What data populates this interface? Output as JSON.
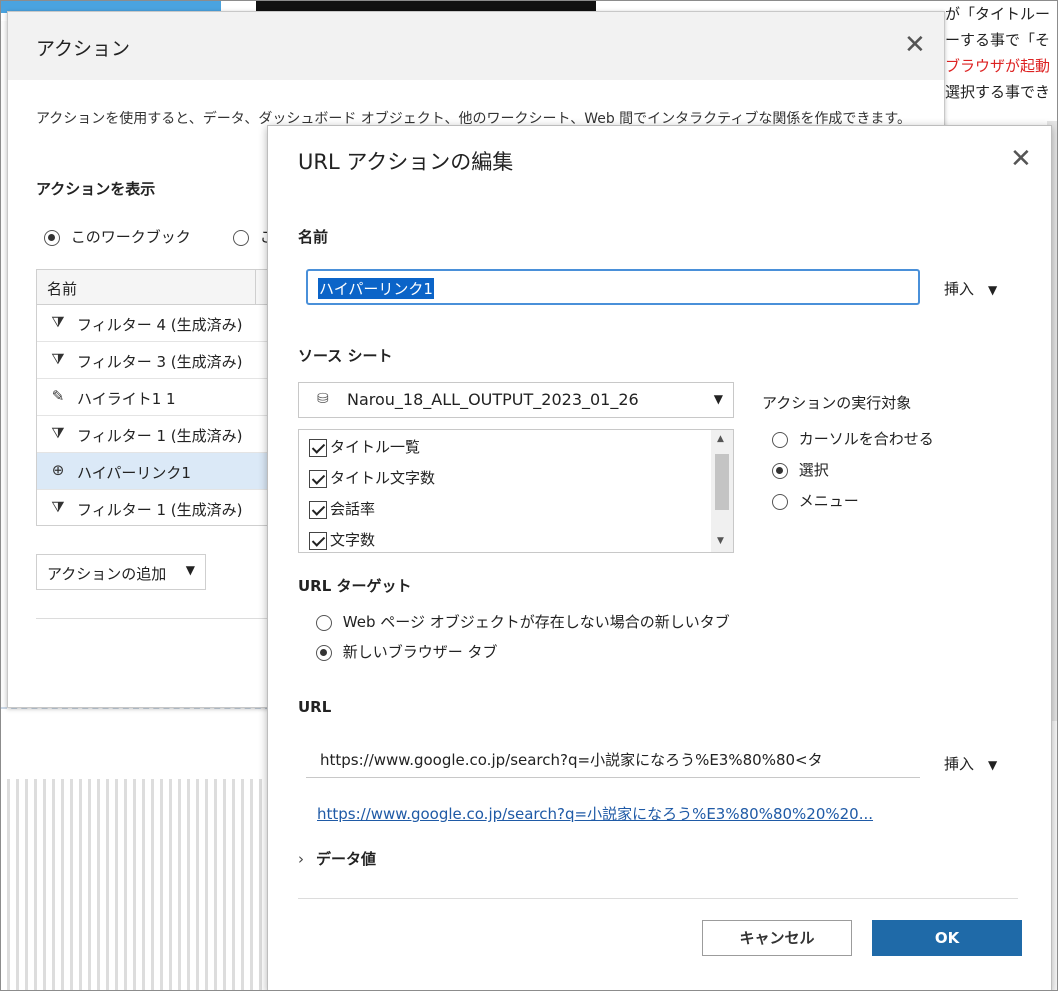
{
  "background": {
    "right_lines": [
      {
        "text": "が「タイトルー",
        "color": "#222222"
      },
      {
        "text": "ーする事で「そ",
        "color": "#222222"
      },
      {
        "text": "ブラウザが起動",
        "color": "#d22222"
      },
      {
        "text": "選択する事でき",
        "color": "#222222"
      }
    ]
  },
  "actions_dialog": {
    "title": "アクション",
    "description": "アクションを使用すると、データ、ダッシュボード オブジェクト、他のワークシート、Web 間でインタラクティブな関係を作成できます。",
    "show_label": "アクションを表示",
    "show_options": [
      {
        "label": "このワークブック",
        "selected": true
      },
      {
        "label": "こ",
        "selected": false
      }
    ],
    "table": {
      "header": "名前",
      "rows": [
        {
          "icon": "filter-icon",
          "label": "フィルター 4 (生成済み)",
          "selected": false
        },
        {
          "icon": "filter-icon",
          "label": "フィルター 3 (生成済み)",
          "selected": false
        },
        {
          "icon": "highlight-icon",
          "label": "ハイライト1 1",
          "selected": false
        },
        {
          "icon": "filter-icon",
          "label": "フィルター 1 (生成済み)",
          "selected": false
        },
        {
          "icon": "globe-icon",
          "label": "ハイパーリンク1",
          "selected": true
        },
        {
          "icon": "filter-icon",
          "label": "フィルター 1 (生成済み)",
          "selected": false
        }
      ]
    },
    "add_button": "アクションの追加"
  },
  "url_dialog": {
    "title": "URL アクションの編集",
    "name_label": "名前",
    "name_value": "ハイパーリンク1",
    "insert_label": "挿入",
    "source_sheet_label": "ソース シート",
    "source_value": "Narou_18_ALL_OUTPUT_2023_01_26",
    "sheets": [
      "タイトル一覧",
      "タイトル文字数",
      "会話率",
      "文字数"
    ],
    "run_on_label": "アクションの実行対象",
    "run_on_options": [
      {
        "label": "カーソルを合わせる",
        "selected": false
      },
      {
        "label": "選択",
        "selected": true
      },
      {
        "label": "メニュー",
        "selected": false
      }
    ],
    "url_target_label": "URL ターゲット",
    "url_target_options": [
      {
        "label": "Web ページ オブジェクトが存在しない場合の新しいタブ",
        "selected": false
      },
      {
        "label": "新しいブラウザー タブ",
        "selected": true
      }
    ],
    "url_label": "URL",
    "url_value": "https://www.google.co.jp/search?q=小説家になろう%E3%80%80<タ",
    "url_link": "https://www.google.co.jp/search?q=小説家になろう%E3%80%80%20%20...",
    "data_values_label": "データ値",
    "cancel_label": "キャンセル",
    "ok_label": "OK"
  }
}
